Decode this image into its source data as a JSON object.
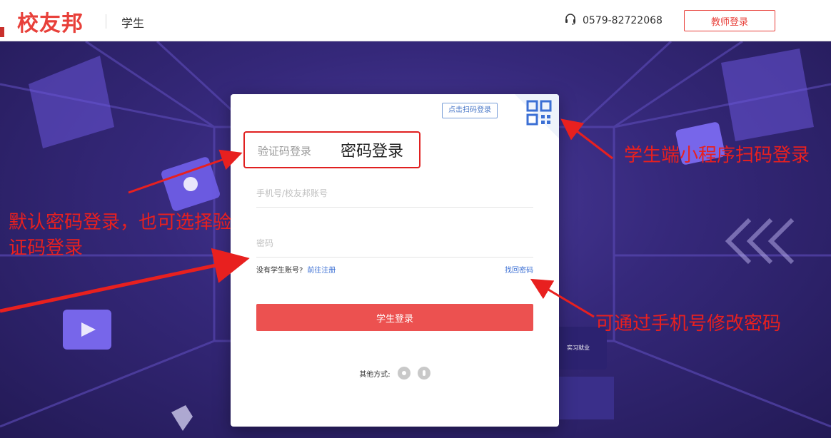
{
  "header": {
    "brand": "校友邦",
    "role": "学生",
    "phone": "0579-82722068",
    "teacher_login": "教师登录"
  },
  "login": {
    "scan_tip": "点击扫码登录",
    "tab_sms": "验证码登录",
    "tab_password": "密码登录",
    "account_placeholder": "手机号/校友邦账号",
    "password_placeholder": "密码",
    "no_account": "没有学生账号?",
    "register": "前往注册",
    "forgot": "找回密码",
    "submit": "学生登录",
    "other_methods": "其他方式:"
  },
  "annotations": {
    "qr_note": "学生端小程序扫码登录",
    "tab_note": "默认密码登录，也可选择验证码登录",
    "forgot_note": "可通过手机号修改密码"
  },
  "colors": {
    "brand": "#e8403a",
    "button": "#ec5150",
    "link": "#3b6fd4",
    "annotation": "#e8201f"
  }
}
